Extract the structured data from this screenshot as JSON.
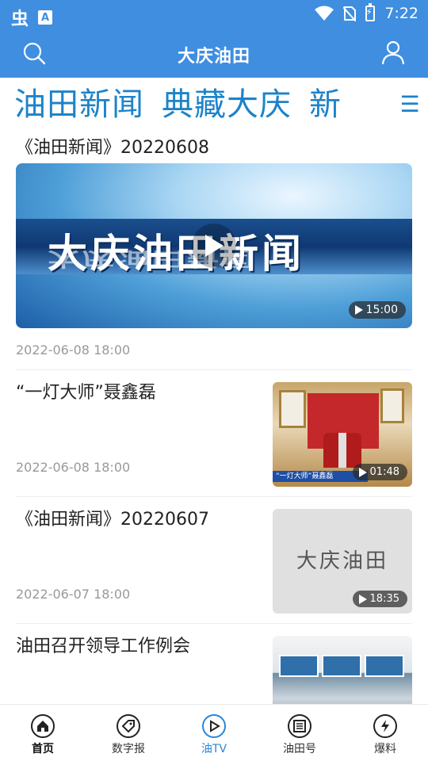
{
  "status_bar": {
    "app_glyph": "虫",
    "a_glyph": "A",
    "time": "7:22"
  },
  "header": {
    "title": "大庆油田"
  },
  "categories": {
    "tabs": [
      "油田新闻",
      "典藏大庆",
      "新"
    ],
    "menu_glyph": "☰"
  },
  "featured": {
    "title": "《油田新闻》20220608",
    "thumb_text": "大庆油田新闻",
    "duration": "15:00",
    "date": "2022-06-08 18:00"
  },
  "list": [
    {
      "title": "“一灯大师”聂鑫磊",
      "date": "2022-06-08 18:00",
      "duration": "01:48",
      "thumb_caption": "“一灯大师”聂鑫磊"
    },
    {
      "title": "《油田新闻》20220607",
      "date": "2022-06-07 18:00",
      "duration": "18:35",
      "thumb_text": "大庆油田"
    },
    {
      "title": "油田召开领导工作例会"
    }
  ],
  "bottom_nav": [
    {
      "label": "首页",
      "icon": "home-icon"
    },
    {
      "label": "数字报",
      "icon": "tag-icon"
    },
    {
      "label": "油TV",
      "icon": "play-icon"
    },
    {
      "label": "油田号",
      "icon": "newspaper-icon"
    },
    {
      "label": "爆料",
      "icon": "bolt-icon"
    }
  ],
  "colors": {
    "brand_blue": "#3f8ee0",
    "tab_blue": "#1d83c9",
    "active_nav": "#2a86d6"
  }
}
